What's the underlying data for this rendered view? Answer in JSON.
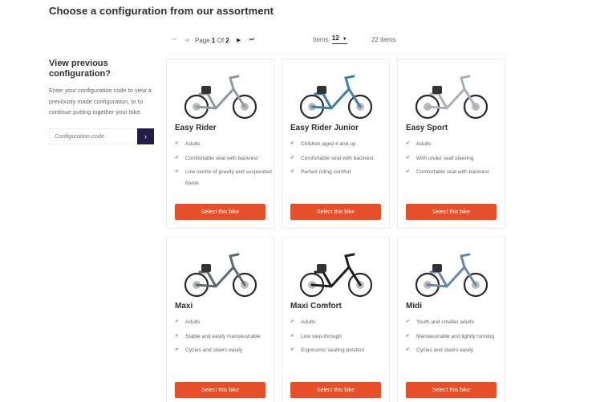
{
  "page": {
    "title": "Choose a configuration from our assortment"
  },
  "pager": {
    "first_icon": "first-page-icon",
    "prev_icon": "prev-page-icon",
    "next_icon": "next-page-icon",
    "last_icon": "last-page-icon",
    "page_label": "Page",
    "current_page": "1",
    "of_label": "Of",
    "total_pages": "2",
    "items_label": "Items:",
    "items_per_page": "12",
    "items_total": "22 items"
  },
  "sidebar": {
    "heading": "View previous configuration?",
    "description": "Enter your configuration code to view a previously made configuration, or to continue putting together your bike.",
    "input_placeholder": "Configuration code",
    "input_value": "",
    "submit_icon": "chevron-right-icon"
  },
  "colors": {
    "accent": "#e5502a",
    "submit_bg": "#221c46",
    "heading": "#2e2e2e"
  },
  "products": [
    {
      "name": "Easy Rider",
      "color": "#8f9a9e",
      "features": [
        "Adults",
        "Comfortable seat with backrest",
        "Low centre of gravity and suspended frame"
      ],
      "button": "Select this bike"
    },
    {
      "name": "Easy Rider Junior",
      "color": "#3f7fa6",
      "features": [
        "Children aged 4 and up",
        "Comfortable seat with backrest",
        "Perfect riding comfort"
      ],
      "button": "Select this bike"
    },
    {
      "name": "Easy Sport",
      "color": "#a9b0b3",
      "features": [
        "Adults",
        "With under seat steering",
        "Comfortable seat with backrest"
      ],
      "button": "Select this bike"
    },
    {
      "name": "Maxi",
      "color": "#5b6b6d",
      "features": [
        "Adults",
        "Stable and easily manoeuvrable",
        "Cycles and steers easily"
      ],
      "button": "Select this bike"
    },
    {
      "name": "Maxi Comfort",
      "color": "#1e1e1e",
      "features": [
        "Adults",
        "Low step-through",
        "Ergonomic seating position"
      ],
      "button": "Select this bike"
    },
    {
      "name": "Midi",
      "color": "#6a86a8",
      "features": [
        "Youth and smaller adults",
        "Manoeuvrable and lightly running",
        "Cycles and steers easily"
      ],
      "button": "Select this bike"
    }
  ]
}
